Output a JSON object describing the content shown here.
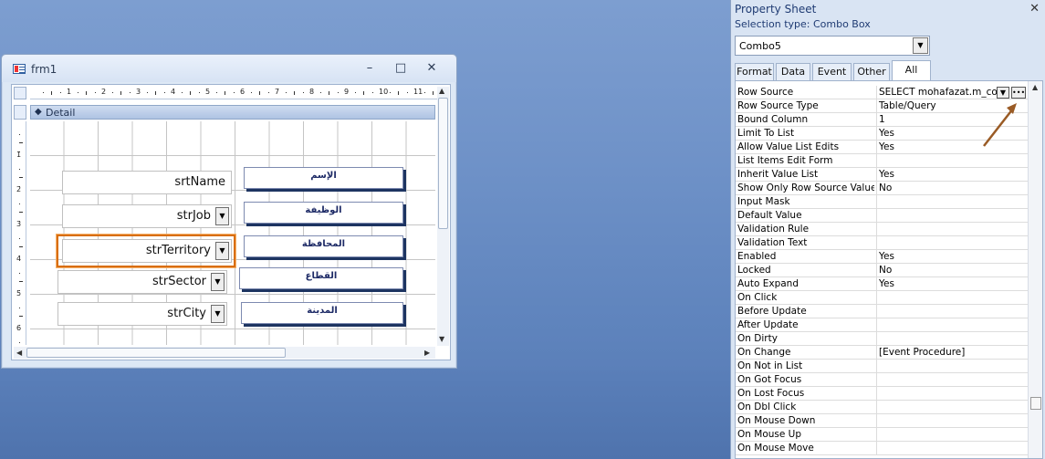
{
  "form_window": {
    "title": "frm1",
    "minimize_glyph": "–",
    "maximize_glyph": "□",
    "close_glyph": "✕",
    "section_label": "Detail",
    "section_icon_glyph": "◆",
    "ruler_h_numbers": [
      "1",
      "2",
      "3",
      "4",
      "5",
      "6",
      "7",
      "8",
      "9",
      "10",
      "11"
    ],
    "ruler_v_numbers": [
      "1",
      "2",
      "3",
      "4",
      "5",
      "6"
    ],
    "fields": [
      {
        "name": "srtName",
        "combo": false
      },
      {
        "name": "strJob",
        "combo": true
      },
      {
        "name": "strTerritory",
        "combo": true,
        "selected": true
      },
      {
        "name": "strSector",
        "combo": true
      },
      {
        "name": "strCity",
        "combo": true
      }
    ],
    "labels": [
      "الإسم",
      "الوظيفة",
      "المحافظة",
      "القطاع",
      "المدينة"
    ],
    "combo_arrow_glyph": "▼",
    "scroll_left_glyph": "◀",
    "scroll_right_glyph": "▶",
    "scroll_up_glyph": "▲",
    "scroll_down_glyph": "▼"
  },
  "property_sheet": {
    "title": "Property Sheet",
    "close_glyph": "✕",
    "selection_type": "Selection type:  Combo Box",
    "object_combo_value": "Combo5",
    "tabs": [
      {
        "label": "Format",
        "active": false
      },
      {
        "label": "Data",
        "active": false
      },
      {
        "label": "Event",
        "active": false
      },
      {
        "label": "Other",
        "active": false
      },
      {
        "label": "All",
        "active": true
      }
    ],
    "rows": [
      {
        "name": "Row Source",
        "value": "SELECT mohafazat.m_cod"
      },
      {
        "name": "Row Source Type",
        "value": "Table/Query"
      },
      {
        "name": "Bound Column",
        "value": "1"
      },
      {
        "name": "Limit To List",
        "value": "Yes"
      },
      {
        "name": "Allow Value List Edits",
        "value": "Yes"
      },
      {
        "name": "List Items Edit Form",
        "value": ""
      },
      {
        "name": "Inherit Value List",
        "value": "Yes"
      },
      {
        "name": "Show Only Row Source Values",
        "value": "No"
      },
      {
        "name": "Input Mask",
        "value": ""
      },
      {
        "name": "Default Value",
        "value": ""
      },
      {
        "name": "Validation Rule",
        "value": ""
      },
      {
        "name": "Validation Text",
        "value": ""
      },
      {
        "name": "Enabled",
        "value": "Yes"
      },
      {
        "name": "Locked",
        "value": "No"
      },
      {
        "name": "Auto Expand",
        "value": "Yes"
      },
      {
        "name": "On Click",
        "value": ""
      },
      {
        "name": "Before Update",
        "value": ""
      },
      {
        "name": "After Update",
        "value": ""
      },
      {
        "name": "On Dirty",
        "value": ""
      },
      {
        "name": "On Change",
        "value": "[Event Procedure]"
      },
      {
        "name": "On Not in List",
        "value": ""
      },
      {
        "name": "On Got Focus",
        "value": ""
      },
      {
        "name": "On Lost Focus",
        "value": ""
      },
      {
        "name": "On Dbl Click",
        "value": ""
      },
      {
        "name": "On Mouse Down",
        "value": ""
      },
      {
        "name": "On Mouse Up",
        "value": ""
      },
      {
        "name": "On Mouse Move",
        "value": ""
      }
    ],
    "row_source_dropdown_glyph": "▼",
    "row_source_builder_glyph": "•••",
    "scroll_up_glyph": "▲"
  },
  "colors": {
    "selection_outline": "#d86e10",
    "annotation_arrow": "#9a5b25",
    "label_shadow": "#1d3461"
  }
}
